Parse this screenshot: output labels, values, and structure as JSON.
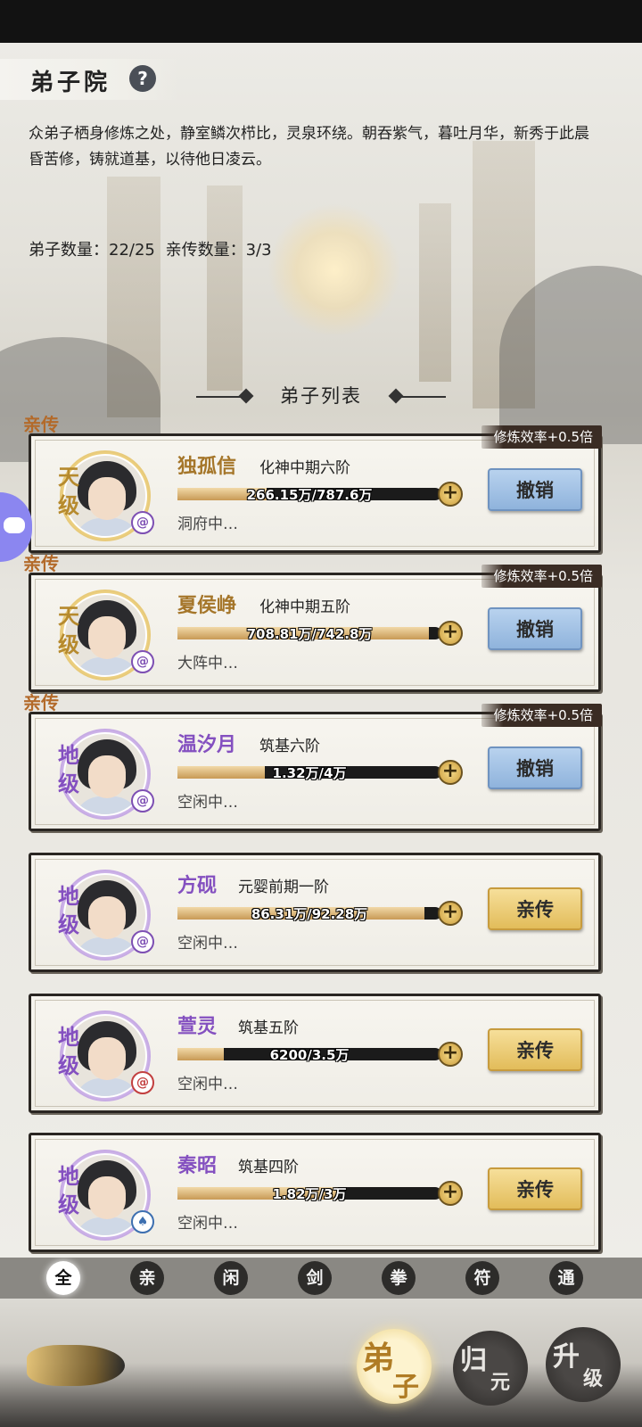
{
  "header": {
    "title": "弟子院",
    "help_icon": "?"
  },
  "description": "众弟子栖身修炼之处，静室鳞次栉比，灵泉环绕。朝吞紫气，暮吐月华，新秀于此晨昏苦修，铸就道基，以待他日凌云。",
  "counts": {
    "disciples": "弟子数量：22/25",
    "direct": "亲传数量：3/3"
  },
  "list_title": "弟子列表",
  "qinchuan_label": "亲传",
  "disciples": [
    {
      "name": "独孤信",
      "realm": "化神中期六阶",
      "rank": "天级",
      "progress_text": "266.15万/787.6万",
      "progress": 0.338,
      "status": "洞府中…",
      "action": "撤销",
      "bonus": "修炼效率+0.5倍",
      "direct": true
    },
    {
      "name": "夏侯峥",
      "realm": "化神中期五阶",
      "rank": "天级",
      "progress_text": "708.81万/742.8万",
      "progress": 0.954,
      "status": "大阵中…",
      "action": "撤销",
      "bonus": "修炼效率+0.5倍",
      "direct": true
    },
    {
      "name": "温汐月",
      "realm": "筑基六阶",
      "rank": "地级",
      "progress_text": "1.32万/4万",
      "progress": 0.33,
      "status": "空闲中…",
      "action": "撤销",
      "bonus": "修炼效率+0.5倍",
      "direct": true
    },
    {
      "name": "方砚",
      "realm": "元婴前期一阶",
      "rank": "地级",
      "progress_text": "86.31万/92.28万",
      "progress": 0.935,
      "status": "空闲中…",
      "action": "亲传",
      "direct": false
    },
    {
      "name": "萱灵",
      "realm": "筑基五阶",
      "rank": "地级",
      "progress_text": "6200/3.5万",
      "progress": 0.177,
      "status": "空闲中…",
      "action": "亲传",
      "direct": false
    },
    {
      "name": "秦昭",
      "realm": "筑基四阶",
      "rank": "地级",
      "progress_text": "1.82万/3万",
      "progress": 0.607,
      "status": "空闲中…",
      "action": "亲传",
      "direct": false
    }
  ],
  "plus_label": "+",
  "filters": [
    "全",
    "亲",
    "闲",
    "剑",
    "拳",
    "符",
    "通"
  ],
  "active_filter": "全",
  "nav": [
    {
      "big": "弟",
      "small": "子"
    },
    {
      "big": "归",
      "small": "元"
    },
    {
      "big": "升",
      "small": "级"
    }
  ],
  "colors": {
    "gold_text": "#a5762a",
    "purple_text": "#8450c0",
    "revoke_btn": "#a9c7ea",
    "direct_btn": "#eccb72"
  }
}
